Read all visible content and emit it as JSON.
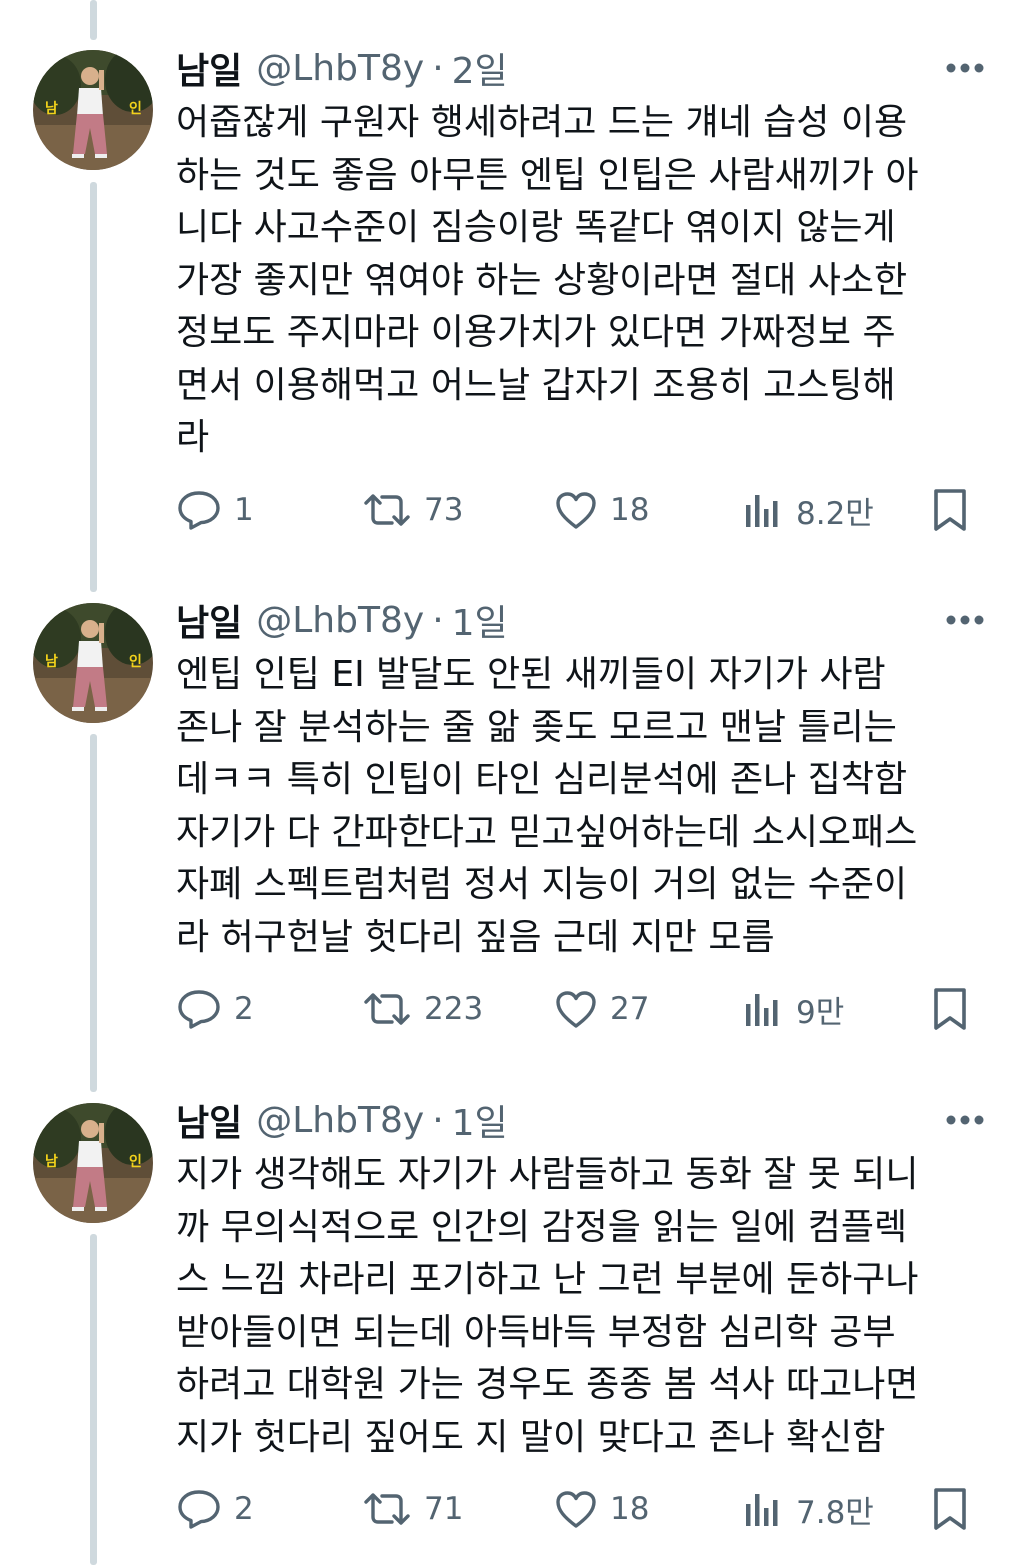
{
  "tweets": [
    {
      "name": "남일",
      "handle": "@LhbT8y",
      "separator": "·",
      "time": "2일",
      "text": "어줍잖게 구원자 행세하려고 드는 걔네 습성 이용\n하는 것도 좋음 아무튼 엔팁 인팁은 사람새끼가 아\n니다 사고수준이 짐승이랑 똑같다 엮이지 않는게\n가장 좋지만 엮여야 하는 상황이라면 절대 사소한\n정보도 주지마라 이용가치가 있다면 가짜정보 주\n면서 이용해먹고 어느날 갑자기 조용히 고스팅해\n라",
      "replies": "1",
      "retweets": "73",
      "likes": "18",
      "views": "8.2만"
    },
    {
      "name": "남일",
      "handle": "@LhbT8y",
      "separator": "·",
      "time": "1일",
      "text": "엔팁 인팁 EI 발달도 안된 새끼들이 자기가 사람\n존나 잘 분석하는 줄 앎 좆도 모르고 맨날 틀리는\n데ㅋㅋ 특히 인팁이 타인 심리분석에 존나 집착함\n자기가 다 간파한다고 믿고싶어하는데 소시오패스\n자폐 스펙트럼처럼 정서 지능이 거의 없는 수준이\n라 허구헌날 헛다리 짚음 근데 지만 모름",
      "replies": "2",
      "retweets": "223",
      "likes": "27",
      "views": "9만"
    },
    {
      "name": "남일",
      "handle": "@LhbT8y",
      "separator": "·",
      "time": "1일",
      "text": "지가 생각해도 자기가 사람들하고 동화 잘 못 되니\n까 무의식적으로 인간의 감정을 읽는 일에 컴플렉\n스 느낌 차라리 포기하고 난 그런 부분에 둔하구나\n받아들이면 되는데 아득바득 부정함 심리학 공부\n하려고 대학원 가는 경우도 종종 봄 석사 따고나면\n지가 헛다리 짚어도 지 말이 맞다고 존나 확신함",
      "replies": "2",
      "retweets": "71",
      "likes": "18",
      "views": "7.8만"
    }
  ],
  "avatar_badge": [
    "남",
    "인"
  ],
  "icons": {
    "more": "more-horizontal-icon",
    "reply": "reply-bubble-icon",
    "retweet": "retweet-icon",
    "like": "heart-icon",
    "views": "views-bar-chart-icon",
    "bookmark": "bookmark-icon"
  },
  "colors": {
    "text": "#0f1419",
    "secondary": "#536471",
    "thread_line": "#cfd9de"
  }
}
